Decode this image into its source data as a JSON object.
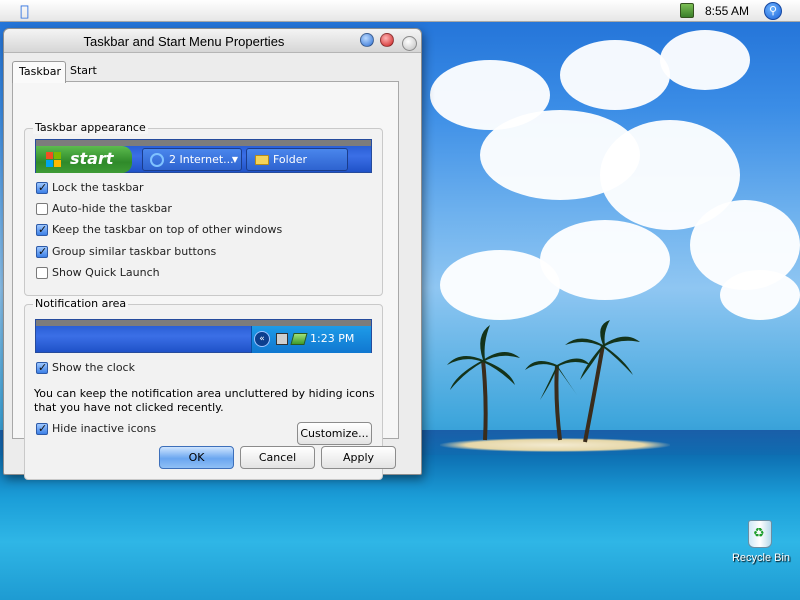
{
  "menubar": {
    "clock": "8:55 AM",
    "apple_icon": "apple-logo-icon",
    "menu_extra_icon": "app-status-icon",
    "spotlight_icon": "spotlight-search-icon"
  },
  "window": {
    "title": "Taskbar and Start Menu Properties",
    "tabs": [
      {
        "label": "Taskbar",
        "active": true
      },
      {
        "label": "Start Menu",
        "active": false
      }
    ],
    "taskbar_appearance": {
      "title": "Taskbar appearance",
      "preview": {
        "start_label": "start",
        "task1_label": "2 Internet...",
        "task2_label": "Folder"
      },
      "options": [
        {
          "label": "Lock the taskbar",
          "checked": true
        },
        {
          "label": "Auto-hide the taskbar",
          "checked": false
        },
        {
          "label": "Keep the taskbar on top of other windows",
          "checked": true
        },
        {
          "label": "Group similar taskbar buttons",
          "checked": true
        },
        {
          "label": "Show Quick Launch",
          "checked": false
        }
      ]
    },
    "notification_area": {
      "title": "Notification area",
      "preview": {
        "time": "1:23 PM"
      },
      "show_clock": {
        "label": "Show the clock",
        "checked": true
      },
      "note": "You can keep the notification area uncluttered by hiding icons that you have not clicked recently.",
      "hide_inactive": {
        "label": "Hide inactive icons",
        "checked": true
      },
      "customize_label": "Customize..."
    },
    "buttons": {
      "ok": "OK",
      "cancel": "Cancel",
      "apply": "Apply"
    }
  },
  "desktop": {
    "recycle_bin_label": "Recycle Bin"
  },
  "colors": {
    "accent": "#3c7fe6",
    "taskbar_blue": "#2a5fd6",
    "start_green": "#2f8a2a"
  }
}
